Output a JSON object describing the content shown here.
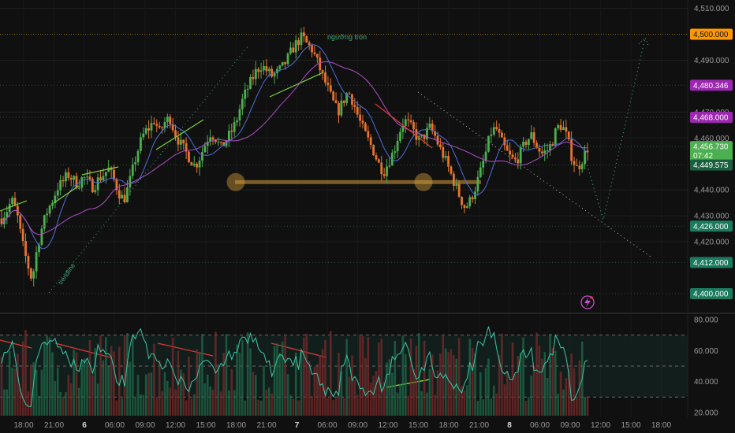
{
  "theme": {
    "background": "#101010",
    "grid": "#1f1f1f",
    "bull": "#4caf50",
    "bear": "#e8742e",
    "axis_text": "#9a9a9a",
    "ma_fast": "#4f6fd8",
    "ma_slow": "#b04fc8",
    "rsi_line": "#39c7a8",
    "trendline": "#3da87a",
    "support_zone": "#d19a3a",
    "red_line": "#e53935",
    "green_line": "#7dd63a"
  },
  "chart_data": [
    {
      "type": "candlestick",
      "pane": "price",
      "title": "",
      "x_tick_labels": [
        "18:00",
        "21:00",
        "6",
        "06:00",
        "09:00",
        "12:00",
        "15:00",
        "18:00",
        "21:00",
        "7",
        "06:00",
        "09:00",
        "12:00",
        "15:00",
        "18:00",
        "21:00",
        "8",
        "06:00",
        "09:00",
        "12:00",
        "15:00",
        "18:00"
      ],
      "y_tick_labels": [
        "4,510.000",
        "4,490.000",
        "4,470.000",
        "4,460.000",
        "4,440.000",
        "4,430.000",
        "4,420.000"
      ],
      "ylim": [
        4393,
        4512
      ],
      "price_badges": [
        {
          "text": "4,500.000",
          "value": 4500,
          "color": "#ff9800",
          "text_color": "#101010"
        },
        {
          "text": "4,480.346",
          "value": 4480.346,
          "color": "#9c27b0",
          "text_color": "#ffffff"
        },
        {
          "text": "4,468.000",
          "value": 4468,
          "color": "#9c27b0",
          "text_color": "#ffffff"
        },
        {
          "text": "4,456.730",
          "sub": "07:42",
          "value": 4456.73,
          "color": "#4caf50",
          "text_color": "#ffffff"
        },
        {
          "text": "4,449.575",
          "value": 4449.575,
          "color": "#1b5e40",
          "text_color": "#ffffff"
        },
        {
          "text": "4,426.000",
          "value": 4426,
          "color": "#1b7a5e",
          "text_color": "#ffffff"
        },
        {
          "text": "4,412.000",
          "value": 4412,
          "color": "#1b7a5e",
          "text_color": "#ffffff"
        },
        {
          "text": "4,400.000",
          "value": 4400,
          "color": "#1b7a5e",
          "text_color": "#ffffff"
        }
      ],
      "annotations": [
        {
          "text": "ngưỡng tròn",
          "value": 4500
        },
        {
          "text": "trendline"
        }
      ],
      "ohlc_anchors": [
        4429,
        4432,
        4436,
        4431,
        4420,
        4412,
        4405,
        4418,
        4426,
        4432,
        4436,
        4441,
        4443,
        4446,
        4444,
        4442,
        4445,
        4443,
        4441,
        4444,
        4446,
        4448,
        4444,
        4439,
        4436,
        4442,
        4450,
        4457,
        4462,
        4464,
        4467,
        4462,
        4466,
        4468,
        4462,
        4458,
        4455,
        4452,
        4449,
        4453,
        4458,
        4462,
        4460,
        4456,
        4459,
        4462,
        4466,
        4473,
        4478,
        4482,
        4486,
        4488,
        4486,
        4484,
        4485,
        4487,
        4490,
        4494,
        4497,
        4499,
        4496,
        4494,
        4489,
        4484,
        4479,
        4474,
        4470,
        4474,
        4478,
        4474,
        4468,
        4463,
        4459,
        4455,
        4450,
        4447,
        4451,
        4455,
        4462,
        4467,
        4465,
        4462,
        4459,
        4461,
        4464,
        4461,
        4456,
        4452,
        4447,
        4442,
        4437,
        4433,
        4436,
        4441,
        4447,
        4454,
        4462,
        4464,
        4459,
        4455,
        4452,
        4451,
        4455,
        4459,
        4461,
        4457,
        4454,
        4455,
        4458,
        4464,
        4465,
        4460,
        4452,
        4448,
        4452,
        4456
      ]
    },
    {
      "type": "volume_rsi",
      "pane": "oscillator",
      "y_tick_labels": [
        "80.000",
        "60.000",
        "40.000",
        "20.000"
      ],
      "ylim": [
        18,
        82
      ],
      "bands": [
        70,
        50,
        30
      ]
    }
  ]
}
